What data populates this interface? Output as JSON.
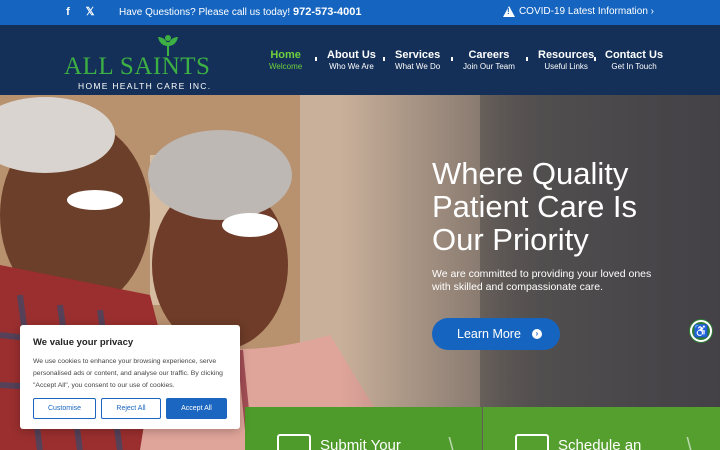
{
  "topbar": {
    "social": [
      {
        "icon": "facebook-icon",
        "glyph": "f"
      },
      {
        "icon": "x-icon",
        "glyph": "𝕏"
      }
    ],
    "question": "Have Questions? Please call us today!",
    "phone": "972-573-4001",
    "covid": "COVID-19 Latest Information ›"
  },
  "logo": {
    "brand": "ALL SAINTS",
    "sub": "HOME HEALTH CARE INC."
  },
  "nav": [
    {
      "title": "Home",
      "sub": "Welcome"
    },
    {
      "title": "About Us",
      "sub": "Who We Are"
    },
    {
      "title": "Services",
      "sub": "What We Do"
    },
    {
      "title": "Careers",
      "sub": "Join Our Team"
    },
    {
      "title": "Resources",
      "sub": "Useful Links"
    },
    {
      "title": "Contact Us",
      "sub": "Get In Touch"
    }
  ],
  "hero": {
    "headline": "Where Quality Patient Care Is Our Priority",
    "lead": "We are committed to providing your loved ones with skilled and compassionate care.",
    "cta": "Learn More"
  },
  "tiles": [
    {
      "label": "Submit Your"
    },
    {
      "label": "Schedule an"
    }
  ],
  "cookie": {
    "title": "We value your privacy",
    "body": "We use cookies to enhance your browsing experience, serve personalised ads or content, and analyse our traffic. By clicking \"Accept All\", you consent to our use of cookies.",
    "customise": "Customise",
    "reject": "Reject All",
    "accept": "Accept All"
  },
  "colors": {
    "topbar": "#1565c0",
    "header": "#143058",
    "accent_green": "#4e9a2a",
    "cta_blue": "#1565c0"
  }
}
